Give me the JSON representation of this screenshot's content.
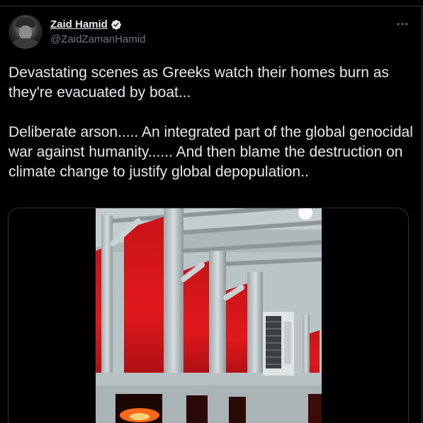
{
  "tweet": {
    "author": {
      "display_name": "Zaid Hamid",
      "handle": "@ZaidZamanHamid",
      "verified": true
    },
    "more_icon": "more-horizontal-icon",
    "text": "Devastating scenes as Greeks watch their homes burn as they're evacuated by boat...\n\nDeliberate arson..... An integrated part of the global genocidal war against humanity...... And then blame the destruction on climate change to justify global depopulation..",
    "media": {
      "type": "video",
      "scene": "ferry-windows-red-fire-glow"
    }
  },
  "colors": {
    "background": "#000000",
    "text": "#e7e9ea",
    "secondary_text": "#71767b",
    "verified": "#1d9bf0",
    "border": "#2f3336",
    "fire_red": "#e0141a"
  }
}
